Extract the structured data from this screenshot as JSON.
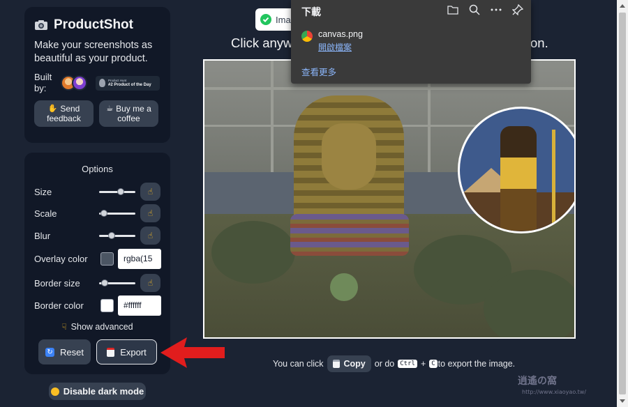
{
  "brand": {
    "title": "ProductShot",
    "tagline": "Make your screenshots as beautiful as your product.",
    "built_by": "Built by:",
    "ph_badge_small": "Product Hunt",
    "ph_badge_big": "#2 Product of the Day"
  },
  "top_buttons": {
    "feedback": [
      "Send",
      "feedback"
    ],
    "coffee": [
      "Buy me a",
      "coffee"
    ]
  },
  "options": {
    "title": "Options",
    "rows": [
      {
        "label": "Size",
        "slider_value": 0.62
      },
      {
        "label": "Scale",
        "slider_value": 0.05
      },
      {
        "label": "Blur",
        "slider_value": 0.3
      },
      {
        "label": "Overlay color",
        "swatch": "#4b5563",
        "value": "rgba(15"
      },
      {
        "label": "Border size",
        "slider_value": 0.08
      },
      {
        "label": "Border color",
        "swatch": "#ffffff",
        "value": "#ffffff"
      }
    ],
    "show_advanced": "Show advanced",
    "reset": "Reset",
    "export": "Export"
  },
  "dark_mode": "Disable dark mode",
  "main": {
    "toast": "Imag",
    "headline_start": "Click anyw",
    "headline_end": "on.",
    "hint_before": "You can click",
    "copy": "Copy",
    "hint_mid": "or do",
    "key_ctrl": "Ctrl",
    "plus": "+",
    "key_c": "C",
    "hint_after": "to export the image."
  },
  "download_panel": {
    "title": "下載",
    "icons": [
      "folder-icon",
      "search-icon",
      "more-icon",
      "pin-icon"
    ],
    "file_name": "canvas.png",
    "open_file": "開啟檔案",
    "see_more": "查看更多"
  },
  "colors": {
    "bg": "#1b2333",
    "card": "#111827",
    "button": "#374151",
    "accent_arrow": "#e11d1d"
  }
}
